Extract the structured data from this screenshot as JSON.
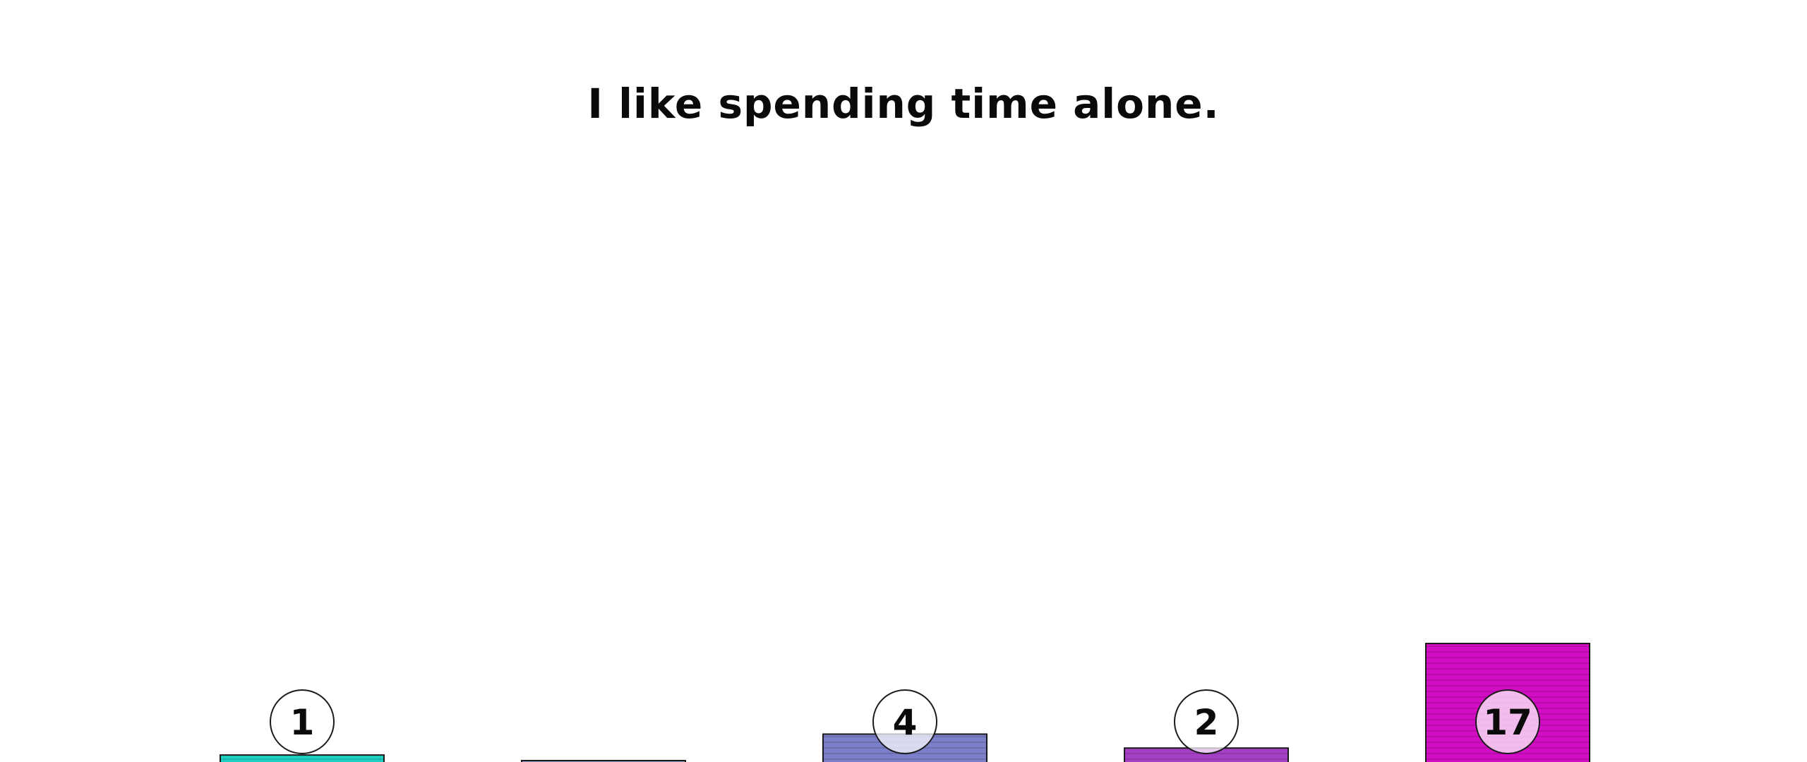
{
  "chart_data": {
    "type": "bar",
    "title": "I like spending time alone.",
    "categories": [],
    "values": [
      1,
      0,
      4,
      2,
      17
    ],
    "colors": [
      "#1fcfc1",
      "#8fa0c8",
      "#7b7fc9",
      "#a440c4",
      "#d30dc3"
    ],
    "ylim": [
      0,
      17
    ],
    "grid": false,
    "legend": "none"
  }
}
